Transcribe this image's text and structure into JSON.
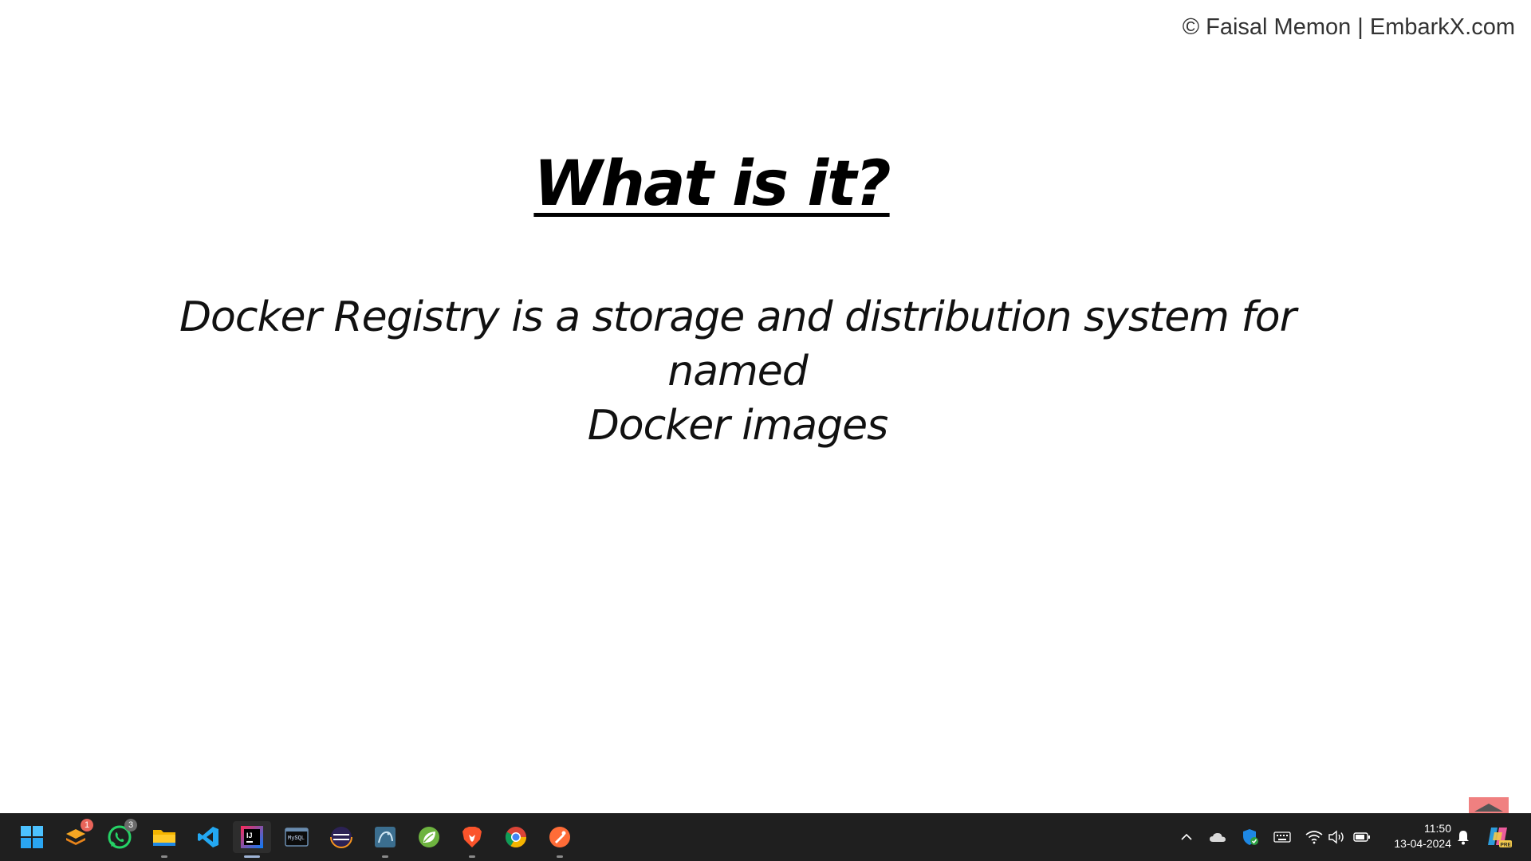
{
  "slide": {
    "copyright": "© Faisal Memon | EmbarkX.com",
    "title": "What is it?",
    "body_line1": "Docker Registry is a storage and distribution system for named",
    "body_line2": "Docker images"
  },
  "taskbar": {
    "apps": [
      {
        "name": "start-button",
        "icon": "windows-logo-icon"
      },
      {
        "name": "taskbar-app-stack",
        "icon": "stack-icon",
        "badge": "1"
      },
      {
        "name": "taskbar-app-whatsapp",
        "icon": "whatsapp-icon",
        "badge": "3"
      },
      {
        "name": "taskbar-app-file-explorer",
        "icon": "folder-icon"
      },
      {
        "name": "taskbar-app-vscode",
        "icon": "vscode-icon"
      },
      {
        "name": "taskbar-app-intellij",
        "icon": "intellij-icon"
      },
      {
        "name": "taskbar-app-terminal",
        "icon": "terminal-icon"
      },
      {
        "name": "taskbar-app-eclipse",
        "icon": "eclipse-icon"
      },
      {
        "name": "taskbar-app-mysql-workbench",
        "icon": "mysql-icon"
      },
      {
        "name": "taskbar-app-spring-tools",
        "icon": "spring-leaf-icon"
      },
      {
        "name": "taskbar-app-brave",
        "icon": "brave-icon"
      },
      {
        "name": "taskbar-app-chrome",
        "icon": "chrome-icon"
      },
      {
        "name": "taskbar-app-postman",
        "icon": "postman-icon"
      }
    ],
    "terminal_icon_text": "MySQL",
    "intellij_icon_text": "IJ",
    "clock": {
      "time": "11:50",
      "date": "13-04-2024"
    },
    "copilot_badge": "PRE",
    "colors": {
      "taskbar_bg": "#1f1f1f",
      "badge_orange": "#e8645a",
      "badge_gray": "#6b6b6b",
      "scroll_button": "#f08080"
    }
  }
}
